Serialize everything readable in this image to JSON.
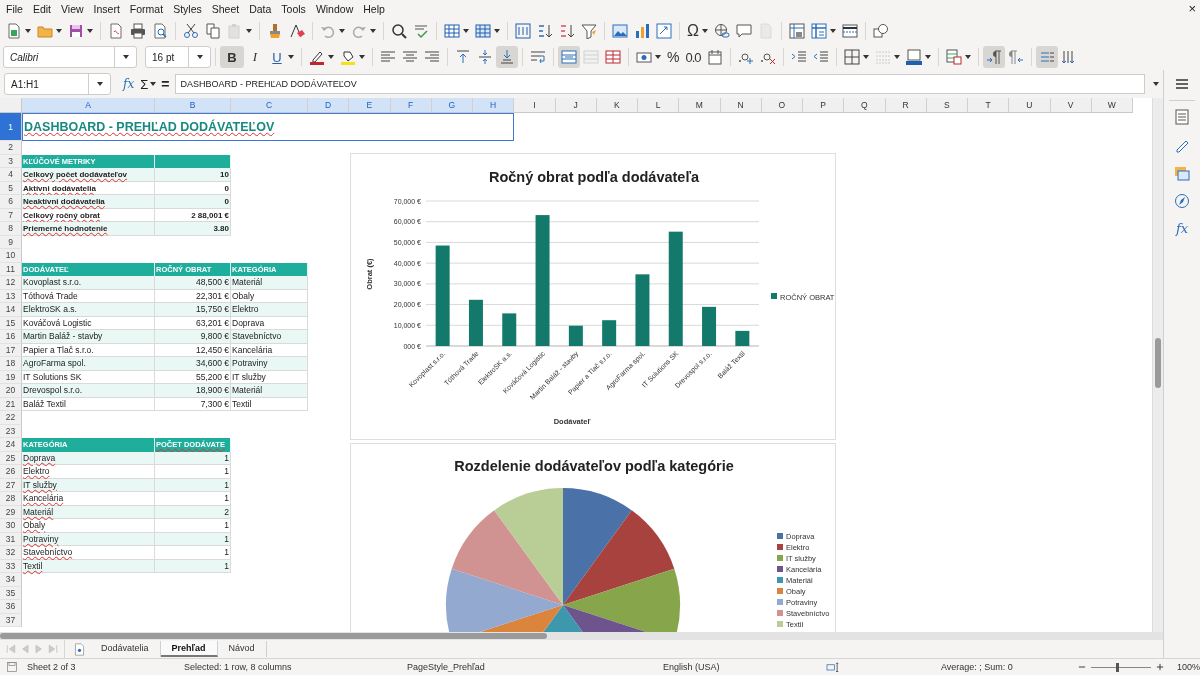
{
  "menu_bar": {
    "items": [
      "File",
      "Edit",
      "View",
      "Insert",
      "Format",
      "Styles",
      "Sheet",
      "Data",
      "Tools",
      "Window",
      "Help"
    ],
    "close_label": "×"
  },
  "standard_toolbar": {
    "special_character_label": "Ω"
  },
  "format_toolbar": {
    "font_name": "Calibri",
    "font_size": "16 pt",
    "bold": {
      "label": "B",
      "on": true
    },
    "italic": {
      "label": "I",
      "on": false
    },
    "underline": {
      "label": "U",
      "on": false
    },
    "percent_label": "%",
    "number_label": "0.0",
    "align_bottom_on": true,
    "merge_center_on": true,
    "paragraph_ltr_on": true,
    "text_flow_on": true
  },
  "formula_bar": {
    "name_box": "A1:H1",
    "function_label": "fx",
    "sum_label": "Σ",
    "equals_label": "=",
    "content": "DASHBOARD - PREHĽAD DODÁVATEĽOV"
  },
  "sidebar": {
    "functions_label": "fx"
  },
  "sheet": {
    "columns": [
      {
        "label": "A",
        "selected": true
      },
      {
        "label": "B",
        "selected": true
      },
      {
        "label": "C",
        "selected": true
      },
      {
        "label": "D",
        "selected": true
      },
      {
        "label": "E",
        "selected": true
      },
      {
        "label": "F",
        "selected": true
      },
      {
        "label": "G",
        "selected": true
      },
      {
        "label": "H",
        "selected": true
      },
      {
        "label": "I",
        "selected": false
      },
      {
        "label": "J",
        "selected": false
      },
      {
        "label": "K",
        "selected": false
      },
      {
        "label": "L",
        "selected": false
      },
      {
        "label": "M",
        "selected": false
      },
      {
        "label": "N",
        "selected": false
      },
      {
        "label": "O",
        "selected": false
      },
      {
        "label": "P",
        "selected": false
      },
      {
        "label": "Q",
        "selected": false
      },
      {
        "label": "R",
        "selected": false
      },
      {
        "label": "S",
        "selected": false
      },
      {
        "label": "T",
        "selected": false
      },
      {
        "label": "U",
        "selected": false
      },
      {
        "label": "V",
        "selected": false
      },
      {
        "label": "W",
        "selected": false
      }
    ],
    "rows": [
      {
        "label": "1",
        "selected": true,
        "cells": [
          {
            "kind": "title",
            "text": "DASHBOARD - PREHĽAD DODÁVATEĽOV",
            "misspelled": true
          }
        ]
      },
      {
        "label": "2",
        "selected": false
      },
      {
        "label": "3",
        "selected": false,
        "cells": [
          {
            "kind": "header",
            "text": "KĽÚČOVÉ METRIKY"
          },
          {
            "kind": "header"
          }
        ]
      },
      {
        "label": "4",
        "selected": false,
        "shaded": true,
        "cells": [
          {
            "kind": "label",
            "text": "Celkový počet dodávateľov",
            "misspelled": true
          },
          {
            "kind": "value",
            "text": "10"
          }
        ]
      },
      {
        "label": "5",
        "selected": false,
        "shaded": false,
        "cells": [
          {
            "kind": "label",
            "text": "Aktívni dodávatelia",
            "misspelled": true
          },
          {
            "kind": "value",
            "text": "0"
          }
        ]
      },
      {
        "label": "6",
        "selected": false,
        "shaded": true,
        "cells": [
          {
            "kind": "label",
            "text": "Neaktívni dodávatelia",
            "misspelled": true
          },
          {
            "kind": "value",
            "text": "0"
          }
        ]
      },
      {
        "label": "7",
        "selected": false,
        "shaded": false,
        "cells": [
          {
            "kind": "label",
            "text": "Celkový ročný obrat",
            "misspelled": true
          },
          {
            "kind": "value",
            "text": "2 88,001 €"
          }
        ]
      },
      {
        "label": "8",
        "selected": false,
        "shaded": true,
        "cells": [
          {
            "kind": "label",
            "text": "Priemerné hodnotenie",
            "misspelled": true
          },
          {
            "kind": "value",
            "text": "3.80"
          }
        ]
      },
      {
        "label": "9",
        "selected": false
      },
      {
        "label": "10",
        "selected": false
      },
      {
        "label": "11",
        "selected": false,
        "cells": [
          {
            "kind": "header",
            "text": "DODÁVATEĽ"
          },
          {
            "kind": "header",
            "text": "ROČNÝ OBRAT"
          },
          {
            "kind": "header",
            "text": "KATEGÓRIA"
          }
        ]
      },
      {
        "label": "12",
        "selected": false,
        "shaded": true,
        "cells": [
          {
            "kind": "text",
            "text": "Kovoplast s.r.o."
          },
          {
            "kind": "number",
            "text": "48,500 €"
          },
          {
            "kind": "text",
            "text": "Materiál"
          }
        ]
      },
      {
        "label": "13",
        "selected": false,
        "shaded": false,
        "cells": [
          {
            "kind": "text",
            "text": "Tóthová Trade"
          },
          {
            "kind": "number",
            "text": "22,301 €"
          },
          {
            "kind": "text",
            "text": "Obaly"
          }
        ]
      },
      {
        "label": "14",
        "selected": false,
        "shaded": true,
        "cells": [
          {
            "kind": "text",
            "text": "ElektroSK a.s."
          },
          {
            "kind": "number",
            "text": "15,750 €"
          },
          {
            "kind": "text",
            "text": "Elektro"
          }
        ]
      },
      {
        "label": "15",
        "selected": false,
        "shaded": false,
        "cells": [
          {
            "kind": "text",
            "text": "Kováčová Logistic"
          },
          {
            "kind": "number",
            "text": "63,201 €"
          },
          {
            "kind": "text",
            "text": "Doprava"
          }
        ]
      },
      {
        "label": "16",
        "selected": false,
        "shaded": true,
        "cells": [
          {
            "kind": "text",
            "text": "Martin Baláž - stavby"
          },
          {
            "kind": "number",
            "text": "9,800 €"
          },
          {
            "kind": "text",
            "text": "Stavebníctvo"
          }
        ]
      },
      {
        "label": "17",
        "selected": false,
        "shaded": false,
        "cells": [
          {
            "kind": "text",
            "text": "Papier a Tlač s.r.o."
          },
          {
            "kind": "number",
            "text": "12,450 €"
          },
          {
            "kind": "text",
            "text": "Kancelária"
          }
        ]
      },
      {
        "label": "18",
        "selected": false,
        "shaded": true,
        "cells": [
          {
            "kind": "text",
            "text": "AgroFarma spol."
          },
          {
            "kind": "number",
            "text": "34,600 €"
          },
          {
            "kind": "text",
            "text": "Potraviny"
          }
        ]
      },
      {
        "label": "19",
        "selected": false,
        "shaded": false,
        "cells": [
          {
            "kind": "text",
            "text": "IT Solutions SK"
          },
          {
            "kind": "number",
            "text": "55,200 €"
          },
          {
            "kind": "text",
            "text": "IT služby"
          }
        ]
      },
      {
        "label": "20",
        "selected": false,
        "shaded": true,
        "cells": [
          {
            "kind": "text",
            "text": "Drevospol s.r.o."
          },
          {
            "kind": "number",
            "text": "18,900 €"
          },
          {
            "kind": "text",
            "text": "Materiál"
          }
        ]
      },
      {
        "label": "21",
        "selected": false,
        "shaded": false,
        "cells": [
          {
            "kind": "text",
            "text": "Baláž Textil"
          },
          {
            "kind": "number",
            "text": "7,300 €"
          },
          {
            "kind": "text",
            "text": "Textil"
          }
        ]
      },
      {
        "label": "22",
        "selected": false
      },
      {
        "label": "23",
        "selected": false
      },
      {
        "label": "24",
        "selected": false,
        "cells": [
          {
            "kind": "header",
            "text": "KATEGÓRIA"
          },
          {
            "kind": "header",
            "text": "POČET DODÁVATE",
            "misspelled": true
          }
        ]
      },
      {
        "label": "25",
        "selected": false,
        "shaded": true,
        "cells": [
          {
            "kind": "text",
            "text": "Doprava",
            "misspelled": true
          },
          {
            "kind": "number",
            "text": "1"
          }
        ]
      },
      {
        "label": "26",
        "selected": false,
        "shaded": false,
        "cells": [
          {
            "kind": "text",
            "text": "Elektro",
            "misspelled": true
          },
          {
            "kind": "number",
            "text": "1"
          }
        ]
      },
      {
        "label": "27",
        "selected": false,
        "shaded": true,
        "cells": [
          {
            "kind": "text",
            "text": "IT služby",
            "misspelled": true
          },
          {
            "kind": "number",
            "text": "1"
          }
        ]
      },
      {
        "label": "28",
        "selected": false,
        "shaded": false,
        "cells": [
          {
            "kind": "text",
            "text": "Kancelária",
            "misspelled": true
          },
          {
            "kind": "number",
            "text": "1"
          }
        ]
      },
      {
        "label": "29",
        "selected": false,
        "shaded": true,
        "cells": [
          {
            "kind": "text",
            "text": "Materiál",
            "misspelled": true
          },
          {
            "kind": "number",
            "text": "2"
          }
        ]
      },
      {
        "label": "30",
        "selected": false,
        "shaded": false,
        "cells": [
          {
            "kind": "text",
            "text": "Obaly",
            "misspelled": true
          },
          {
            "kind": "number",
            "text": "1"
          }
        ]
      },
      {
        "label": "31",
        "selected": false,
        "shaded": true,
        "cells": [
          {
            "kind": "text",
            "text": "Potraviny",
            "misspelled": true
          },
          {
            "kind": "number",
            "text": "1"
          }
        ]
      },
      {
        "label": "32",
        "selected": false,
        "shaded": false,
        "cells": [
          {
            "kind": "text",
            "text": "Stavebníctvo",
            "misspelled": true
          },
          {
            "kind": "number",
            "text": "1"
          }
        ]
      },
      {
        "label": "33",
        "selected": false,
        "shaded": true,
        "cells": [
          {
            "kind": "text",
            "text": "Textil",
            "misspelled": true
          },
          {
            "kind": "number",
            "text": "1"
          }
        ]
      },
      {
        "label": "34",
        "selected": false
      },
      {
        "label": "35",
        "selected": false
      },
      {
        "label": "36",
        "selected": false
      },
      {
        "label": "37",
        "selected": false
      }
    ]
  },
  "charts": [
    {
      "chart_data": {
        "type": "bar",
        "title": "Ročný obrat podľa dodávateľa",
        "xlabel": "Dodávateľ",
        "ylabel": "Obrat (€)",
        "categories": [
          "Kovoplast s.r.o.",
          "Tóthová Trade",
          "ElektroSK a.s.",
          "Kováčová Logistic",
          "Martin Baláž - stavby",
          "Papier a Tlač s.r.o.",
          "AgroFarma spol.",
          "IT Solutions SK",
          "Drevospol s.r.o.",
          "Baláž Textil"
        ],
        "series": [
          {
            "name": "ROČNÝ OBRAT",
            "color": "#137a6b",
            "values": [
              48500,
              22301,
              15750,
              63201,
              9800,
              12450,
              34600,
              55200,
              18900,
              7300
            ]
          }
        ],
        "grid": true,
        "legend": true,
        "ylim": [
          0,
          70000
        ],
        "yticks": [
          {
            "value": 0,
            "label": "000 €"
          },
          {
            "value": 10000,
            "label": "10,000 €"
          },
          {
            "value": 20000,
            "label": "20,000 €"
          },
          {
            "value": 30000,
            "label": "30,000 €"
          },
          {
            "value": 40000,
            "label": "40,000 €"
          },
          {
            "value": 50000,
            "label": "50,000 €"
          },
          {
            "value": 60000,
            "label": "60,000 €"
          },
          {
            "value": 70000,
            "label": "70,000 €"
          }
        ]
      }
    },
    {
      "chart_data": {
        "type": "pie",
        "title": "Rozdelenie dodávateľov podľa kategórie",
        "categories": [
          "Doprava",
          "Elektro",
          "IT služby",
          "Kancelária",
          "Materiál",
          "Obaly",
          "Potraviny",
          "Stavebníctvo",
          "Textil"
        ],
        "series": [
          {
            "values": [
              10,
              10,
              10,
              10,
              20,
              10,
              10,
              10,
              10
            ]
          }
        ],
        "legend": true,
        "colors": [
          "#4a72a8",
          "#a8423f",
          "#87a54a",
          "#6e548d",
          "#3d97ad",
          "#db843d",
          "#93a9cf",
          "#d19392",
          "#b9cd96"
        ]
      }
    }
  ],
  "sheet_tabs": [
    {
      "label": "Dodávatelia",
      "selected": false
    },
    {
      "label": "Prehľad",
      "selected": true
    },
    {
      "label": "Návod",
      "selected": false
    }
  ],
  "status_bar": {
    "sheet_position": "Sheet 2 of 3",
    "selection": "Selected: 1 row, 8 columns",
    "page_style": "PageStyle_Prehľad",
    "language": "English (USA)",
    "summary": "Average: ; Sum: 0",
    "zoom": {
      "level": 0.43,
      "reading": "100%"
    }
  }
}
